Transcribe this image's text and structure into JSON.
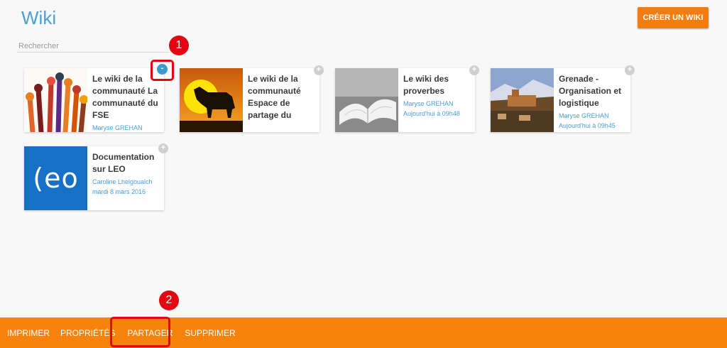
{
  "page": {
    "title": "Wiki",
    "create_label": "CRÉER UN WIKI"
  },
  "search": {
    "placeholder": "Rechercher"
  },
  "cards": [
    {
      "title": "Le wiki de la communauté La communauté du FSE",
      "author": "Maryse GREHAN",
      "date": "",
      "toggle": "-"
    },
    {
      "title": "Le wiki de la communauté Espace de partage du voyage en",
      "author": "",
      "date": "",
      "toggle": "+"
    },
    {
      "title": "Le wiki des proverbes",
      "author": "Maryse GREHAN",
      "date": "Aujourd'hui à 09h48",
      "toggle": "+"
    },
    {
      "title": "Grenade - Organisation et logistique",
      "author": "Maryse GREHAN",
      "date": "Aujourd'hui à 09h45",
      "toggle": "+"
    },
    {
      "title": "Documentation sur LEO",
      "author": "Caroline Lhelgoualch",
      "date": "mardi 8 mars 2016",
      "toggle": "+"
    }
  ],
  "thumbnail_text": {
    "leo_logo": "(eo"
  },
  "toolbar": {
    "print": "IMPRIMER",
    "properties": "PROPRIÉTÉS",
    "share": "PARTAGER",
    "delete": "SUPPRIMER"
  },
  "annotations": {
    "marker1": "1",
    "marker2": "2"
  },
  "colors": {
    "accent": "#f7830d",
    "link": "#4a9fd5",
    "marker": "#e30613"
  }
}
